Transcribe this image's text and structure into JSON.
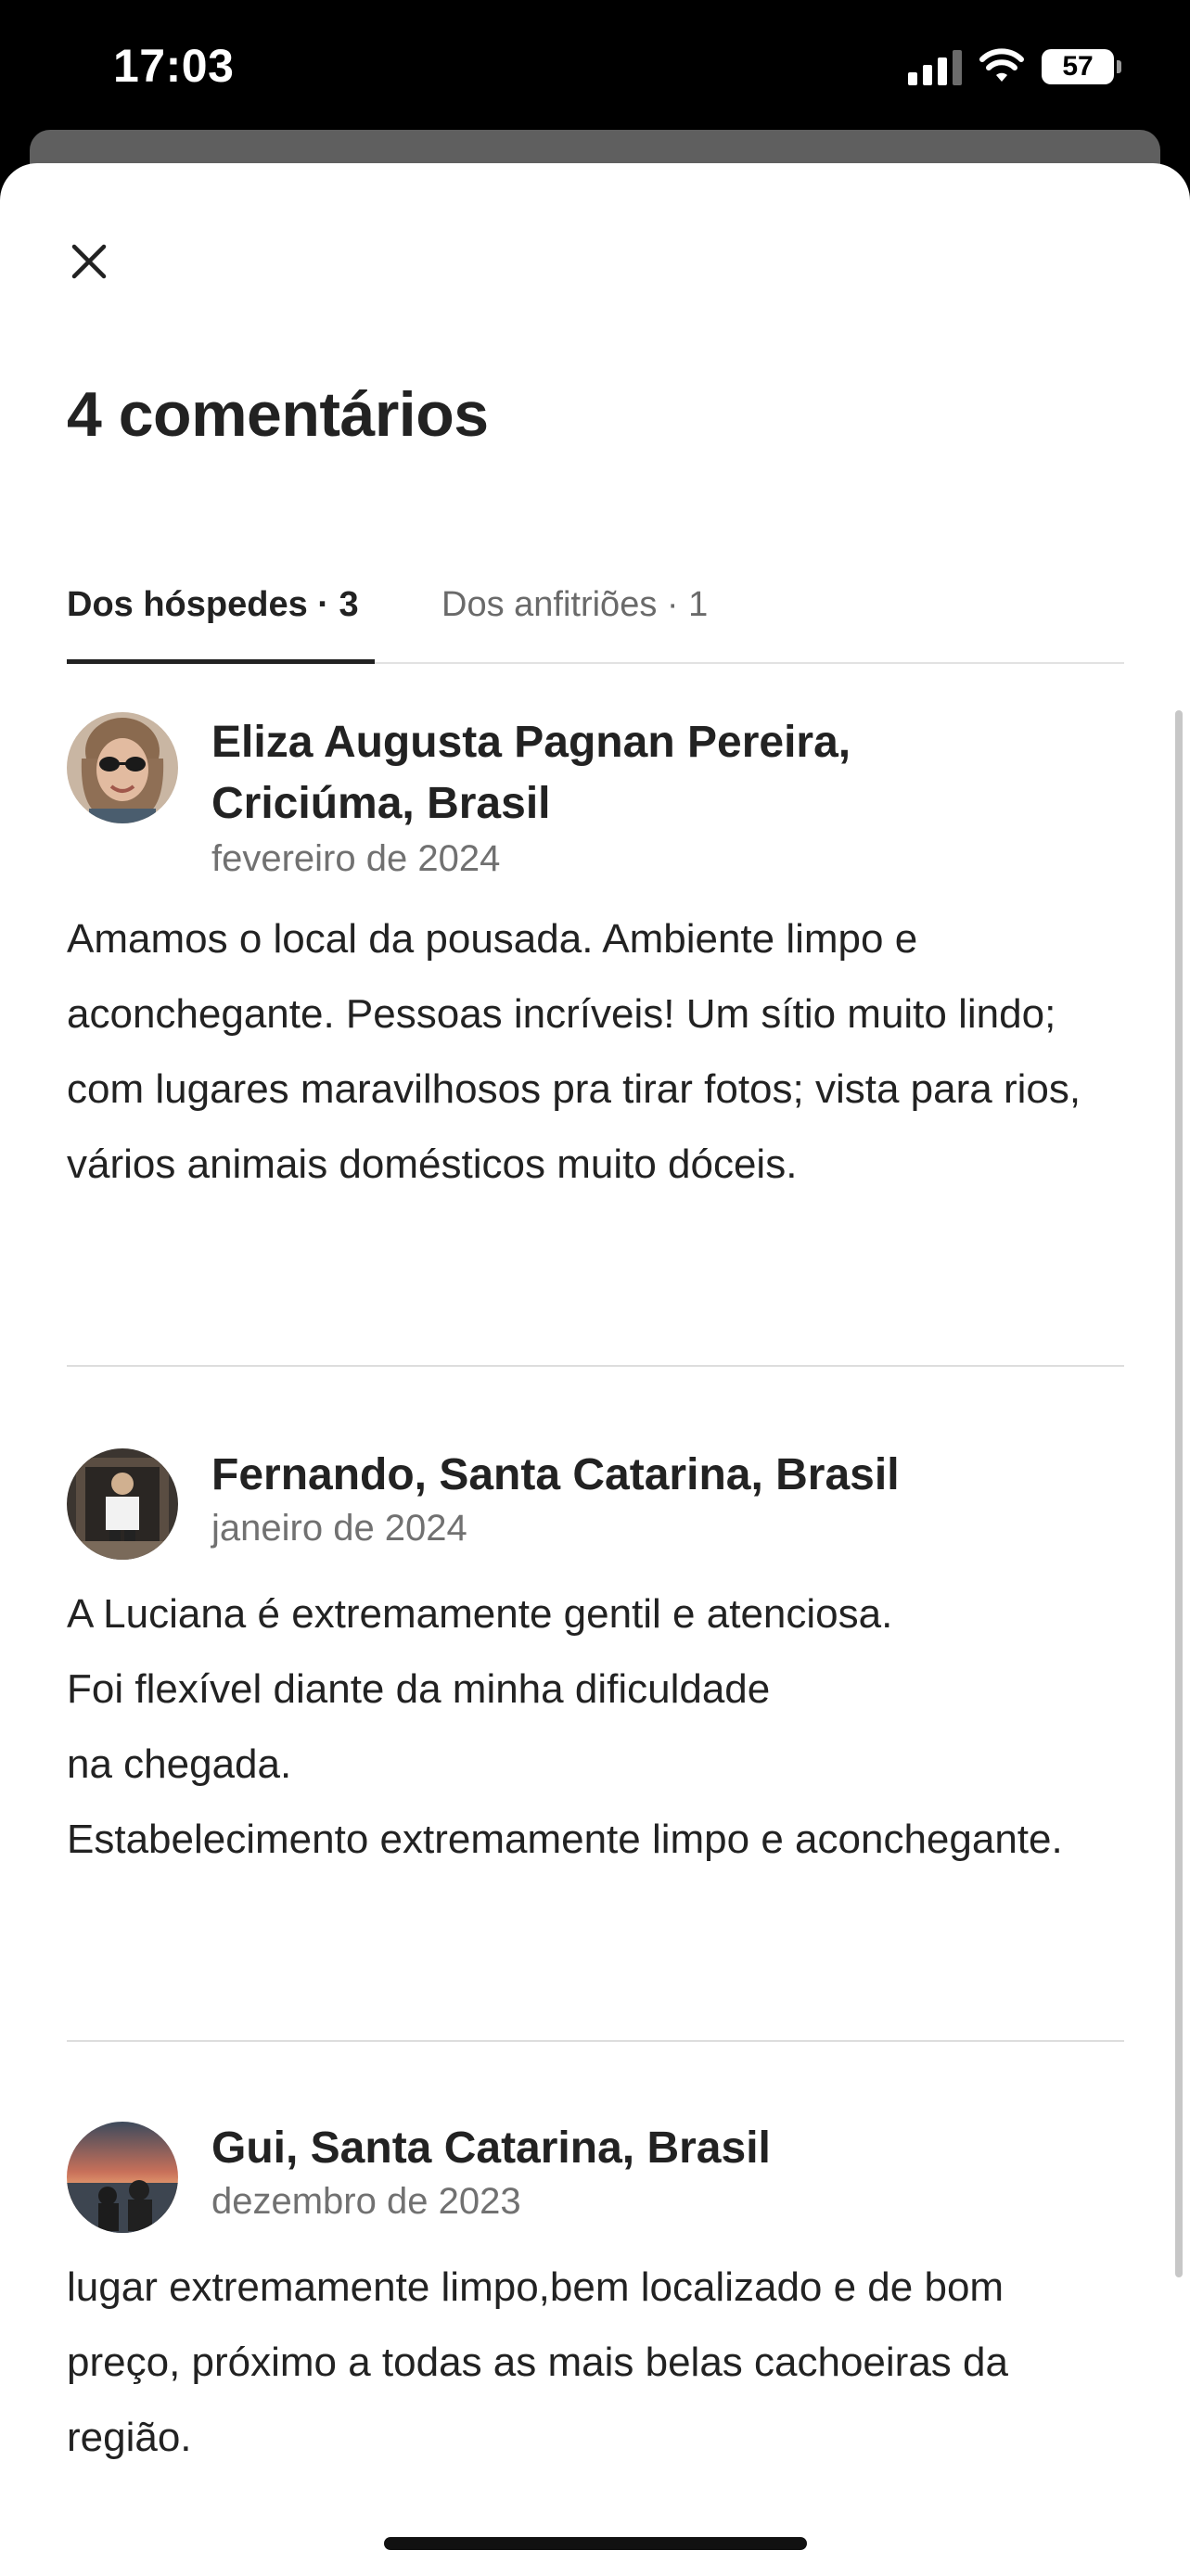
{
  "status_bar": {
    "time": "17:03",
    "battery": "57",
    "icons": [
      "signal-icon",
      "wifi-icon",
      "battery-icon"
    ]
  },
  "sheet": {
    "close_icon": "close-icon",
    "title": "4 comentários",
    "tabs": [
      {
        "label": "Dos hóspedes · 3",
        "active": true
      },
      {
        "label": "Dos anfitriões · 1",
        "active": false
      }
    ]
  },
  "reviews": [
    {
      "name": "Eliza Augusta Pagnan Pereira,\nCriciúma, Brasil",
      "date": "fevereiro de 2024",
      "text": "Amamos o local da pousada. Ambiente limpo e aconchegante. Pessoas incríveis! Um sítio muito lindo; com lugares maravilhosos pra tirar fotos; vista para rios, vários animais domésticos muito dóceis."
    },
    {
      "name": "Fernando, Santa Catarina, Brasil",
      "date": "janeiro de 2024",
      "text": "A Luciana é extremamente gentil e atenciosa.\nFoi flexível diante da minha dificuldade\nna chegada.\nEstabelecimento extremamente limpo e aconchegante."
    },
    {
      "name": "Gui, Santa Catarina, Brasil",
      "date": "dezembro de 2023",
      "text": "lugar extremamente limpo,bem localizado e de bom preço, próximo a todas as mais belas cachoeiras da região."
    }
  ],
  "colors": {
    "text_primary": "#222222",
    "text_secondary": "#717171",
    "divider": "#dddddd"
  }
}
